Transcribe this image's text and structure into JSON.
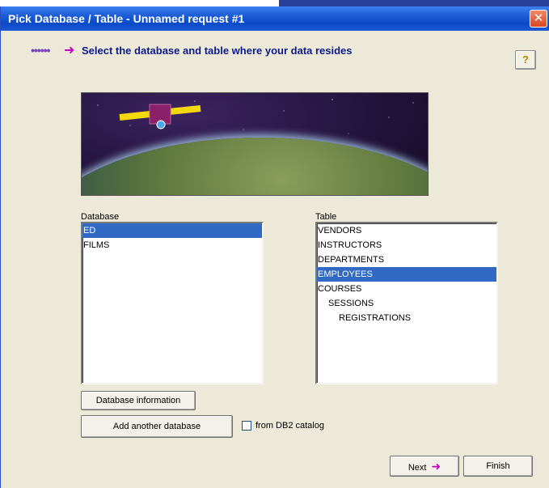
{
  "window": {
    "title": "Pick Database / Table - Unnamed request #1",
    "close_icon": "close-icon"
  },
  "header": {
    "dots": "••••••",
    "arrow": "➜",
    "instruction": "Select the database and  table where your data resides",
    "help_label": "?"
  },
  "banner": {
    "image": "satellite-over-earth"
  },
  "database": {
    "label": "Database",
    "items": [
      "ED",
      "FILMS"
    ],
    "selected": "ED"
  },
  "table": {
    "label": "Table",
    "items": [
      {
        "label": "VENDORS",
        "level": 0
      },
      {
        "label": "INSTRUCTORS",
        "level": 0
      },
      {
        "label": "DEPARTMENTS",
        "level": 0
      },
      {
        "label": "EMPLOYEES",
        "level": 0
      },
      {
        "label": "COURSES",
        "level": 0
      },
      {
        "label": "SESSIONS",
        "level": 1
      },
      {
        "label": "REGISTRATIONS",
        "level": 2
      }
    ],
    "selected": "EMPLOYEES"
  },
  "buttons": {
    "database_information": "Database information",
    "add_another_database": "Add another database",
    "next": "Next",
    "next_arrow": "➜",
    "finish": "Finish"
  },
  "checkbox": {
    "label": "from DB2 catalog",
    "checked": false
  }
}
